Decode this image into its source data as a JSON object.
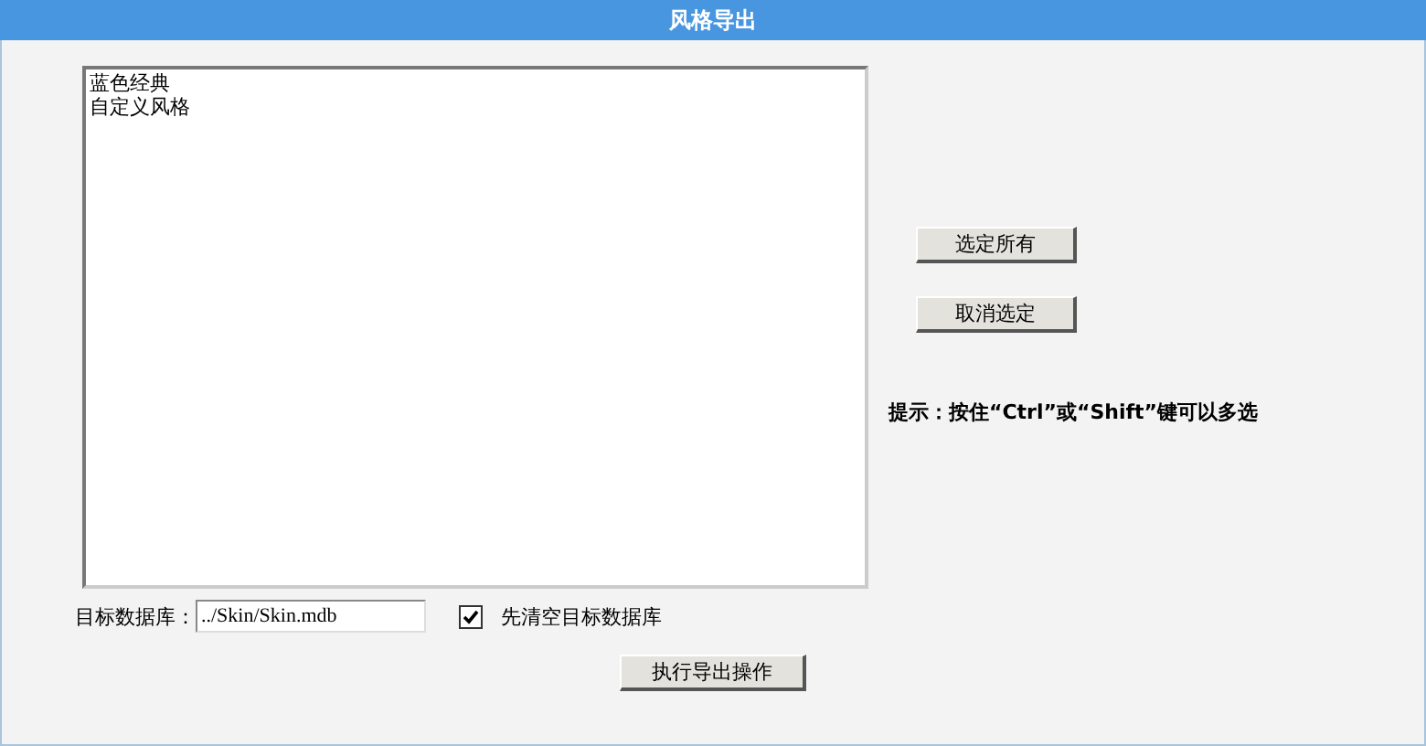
{
  "window": {
    "title": "风格导出"
  },
  "style_list": {
    "items": [
      {
        "label": "蓝色经典",
        "selected": false
      },
      {
        "label": "自定义风格",
        "selected": false
      }
    ]
  },
  "buttons": {
    "select_all": "选定所有",
    "deselect": "取消选定"
  },
  "hint": "提示：按住“Ctrl”或“Shift”键可以多选",
  "target_db": {
    "label": "目标数据库：",
    "value": "../Skin/Skin.mdb"
  },
  "clear_option": {
    "label": "先清空目标数据库",
    "checked": true
  },
  "execute_button": "执行导出操作"
}
